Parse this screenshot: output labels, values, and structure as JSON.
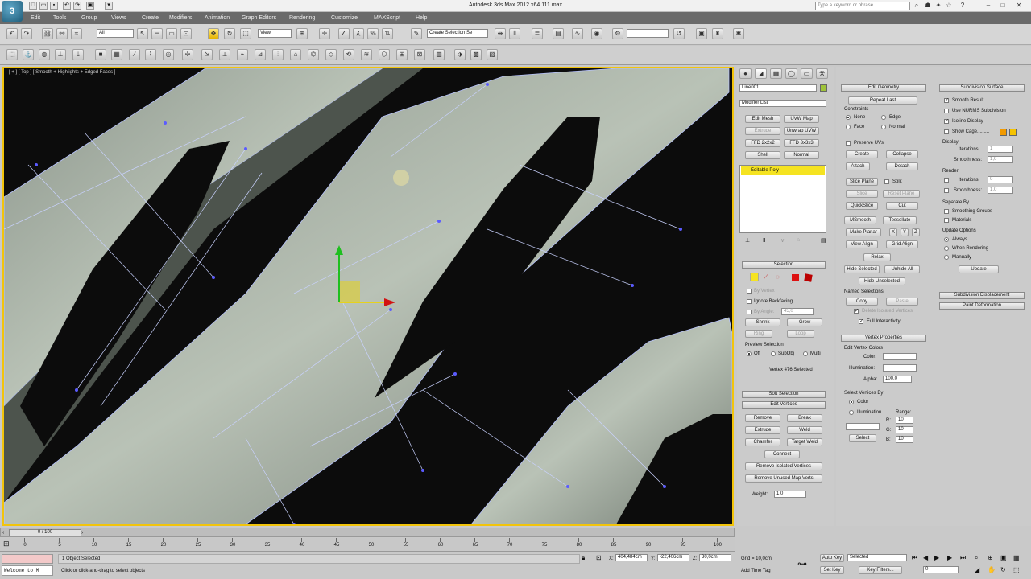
{
  "app": {
    "title": "Autodesk 3ds Max 2012 x64      111.max",
    "logo_text": "3",
    "search_placeholder": "Type a keyword or phrase"
  },
  "menu": [
    "Edit",
    "Tools",
    "Group",
    "Views",
    "Create",
    "Modifiers",
    "Animation",
    "Graph Editors",
    "Rendering",
    "Customize",
    "MAXScript",
    "Help"
  ],
  "toolbar": {
    "selection_filter": "All",
    "reference_coord": "View",
    "named_selection": "Create Selection Se",
    "active_tool": "select-move"
  },
  "viewport": {
    "label": "[ + ] [ Top ] [ Smooth + Highlights + Edged Faces ]"
  },
  "cmd_panel": {
    "object_name": "Line001",
    "object_color": "#9fc33a",
    "modifier_list": "Modifier List",
    "mod_buttons": [
      "Edit Mesh",
      "UVW Map",
      "Extrude",
      "Unwrap UVW",
      "FFD 2x2x2",
      "FFD 3x3x3",
      "Shell",
      "Normal"
    ],
    "stack_item": "Editable Poly",
    "selection_title": "Selection",
    "by_vertex": "By Vertex",
    "ignore_backfacing": "Ignore Backfacing",
    "by_angle": "By Angle:",
    "by_angle_value": "45,0",
    "shrink": "Shrink",
    "grow": "Grow",
    "ring": "Ring",
    "loop": "Loop",
    "preview_selection": "Preview Selection",
    "preview_off": "Off",
    "preview_subobj": "SubObj",
    "preview_multi": "Multi",
    "selected_count": "Vertex 476 Selected",
    "soft_selection": "Soft Selection",
    "edit_vertices": "Edit Vertices",
    "remove": "Remove",
    "break": "Break",
    "extrude": "Extrude",
    "weld": "Weld",
    "chamfer": "Chamfer",
    "target_weld": "Target Weld",
    "connect": "Connect",
    "remove_isolated": "Remove Isolated Vertices",
    "remove_unused": "Remove Unused Map Verts",
    "weight_label": "Weight:",
    "weight_value": "1,0"
  },
  "edit_geometry": {
    "title": "Edit Geometry",
    "repeat_last": "Repeat Last",
    "constraints": "Constraints",
    "c_none": "None",
    "c_edge": "Edge",
    "c_face": "Face",
    "c_normal": "Normal",
    "preserve_uvs": "Preserve UVs",
    "create": "Create",
    "collapse": "Collapse",
    "attach": "Attach",
    "detach": "Detach",
    "slice_plane": "Slice Plane",
    "split": "Split",
    "slice": "Slice",
    "reset_plane": "Reset Plane",
    "quickslice": "QuickSlice",
    "cut": "Cut",
    "msmooth": "MSmooth",
    "tessellate": "Tessellate",
    "make_planar": "Make Planar",
    "x": "X",
    "y": "Y",
    "z": "Z",
    "view_align": "View Align",
    "grid_align": "Grid Align",
    "relax": "Relax",
    "hide_selected": "Hide Selected",
    "unhide_all": "Unhide All",
    "hide_unselected": "Hide Unselected",
    "named_selections": "Named Selections:",
    "copy": "Copy",
    "paste": "Paste",
    "delete_isolated": "Delete Isolated Vertices",
    "full_interactivity": "Full Interactivity",
    "vertex_properties": "Vertex Properties",
    "edit_vertex_colors": "Edit Vertex Colors",
    "color": "Color:",
    "illumination": "Illumination:",
    "alpha": "Alpha:",
    "alpha_value": "100,0",
    "select_vertices_by": "Select Vertices By",
    "sv_color": "Color",
    "sv_illum": "Illumination",
    "range": "Range:",
    "r": "R:",
    "g": "G:",
    "b": "B:",
    "rgb_value": "10",
    "select": "Select"
  },
  "subdivision": {
    "title": "Subdivision Surface",
    "smooth_result": "Smooth Result",
    "use_nurms": "Use NURMS Subdivision",
    "isoline": "Isoline Display",
    "show_cage": "Show Cage.........",
    "cage_color_1": "#f29a00",
    "cage_color_2": "#f5c200",
    "display": "Display",
    "iterations": "Iterations:",
    "iterations_value": "1",
    "smoothness": "Smoothness:",
    "smoothness_value": "1,0",
    "render": "Render",
    "r_iterations_value": "0",
    "r_smoothness_value": "1,0",
    "separate_by": "Separate By",
    "smoothing_groups": "Smoothing Groups",
    "materials": "Materials",
    "update_options": "Update Options",
    "always": "Always",
    "when_rendering": "When Rendering",
    "manually": "Manually",
    "update": "Update",
    "subdivision_displacement": "Subdivision Displacement",
    "paint_deformation": "Paint Deformation"
  },
  "timeline": {
    "frame": "0 / 100",
    "ticks": [
      "0",
      "5",
      "10",
      "15",
      "20",
      "25",
      "30",
      "35",
      "40",
      "45",
      "50",
      "55",
      "60",
      "65",
      "70",
      "75",
      "80",
      "85",
      "90",
      "95",
      "100"
    ]
  },
  "status": {
    "maxscript": "Welcome to M",
    "object_selected": "1 Object Selected",
    "prompt": "Click or click-and-drag to select objects",
    "x_label": "X:",
    "x_value": "404,484cm",
    "y_label": "Y:",
    "y_value": "-22,406cm",
    "z_label": "Z:",
    "z_value": "30,0cm",
    "grid": "Grid = 10,0cm",
    "add_time_tag": "Add Time Tag",
    "auto_key": "Auto Key",
    "selected": "Selected",
    "set_key": "Set Key",
    "key_filters": "Key Filters...",
    "current_frame": "0"
  }
}
